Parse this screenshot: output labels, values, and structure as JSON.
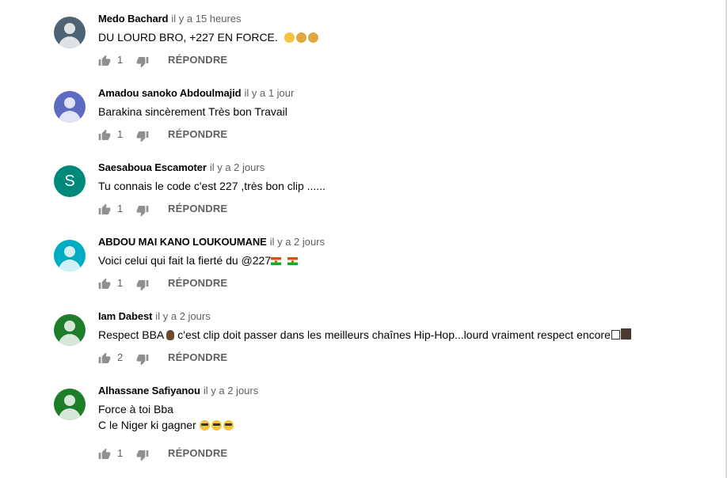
{
  "comments": [
    {
      "author": "Medo Bachard",
      "time": "il y a 15 heures",
      "text_lines": [
        "DU LOURD BRO, +227 EN FORCE."
      ],
      "emojis": [
        "fist-emoji",
        "praying-hands-emoji",
        "praying-hands-emoji"
      ],
      "likes": "1",
      "avatar_color": "#4f6271",
      "avatar_type": "silhouette"
    },
    {
      "author": "Amadou sanoko Abdoulmajid",
      "time": "il y a 1 jour",
      "text_lines": [
        "Barakina sincèrement Très bon Travail"
      ],
      "likes": "1",
      "avatar_color": "#5c6bc0",
      "avatar_type": "silhouette"
    },
    {
      "author": "Saesaboua Escamoter",
      "time": "il y a 2 jours",
      "text_lines": [
        "Tu connais le code c'est 227 ,très bon clip ......"
      ],
      "likes": "1",
      "avatar_color": "#00897b",
      "avatar_type": "initial",
      "avatar_initial": "S"
    },
    {
      "author": "ABDOU MAI KANO LOUKOUMANE",
      "time": "il y a 2 jours",
      "text_lines": [
        "Voici celui qui fait la fierté du @227"
      ],
      "emojis": [
        "niger-flag-emoji",
        "niger-flag-emoji"
      ],
      "likes": "1",
      "avatar_color": "#00acc1",
      "avatar_type": "silhouette"
    },
    {
      "author": "Iam Dabest",
      "time": "il y a 2 jours",
      "text_lines": [
        "Respect BBA",
        "c'est clip doit passer dans les meilleurs chaînes Hip-Hop...lourd vraiment respect encore"
      ],
      "likes": "2",
      "avatar_color": "#1e7d2a",
      "avatar_type": "silhouette"
    },
    {
      "author": "Alhassane Safiyanou",
      "time": "il y a 2 jours",
      "text_lines": [
        "Force à toi Bba",
        "C le Niger ki gagner"
      ],
      "emojis": [
        "sunglasses-emoji",
        "sunglasses-emoji",
        "sunglasses-emoji"
      ],
      "likes": "1",
      "avatar_color": "#1e7d2a",
      "avatar_type": "silhouette"
    }
  ],
  "reply_label": "RÉPONDRE",
  "colors": {
    "author": "#030303",
    "meta": "#606060",
    "icon": "#909090"
  }
}
